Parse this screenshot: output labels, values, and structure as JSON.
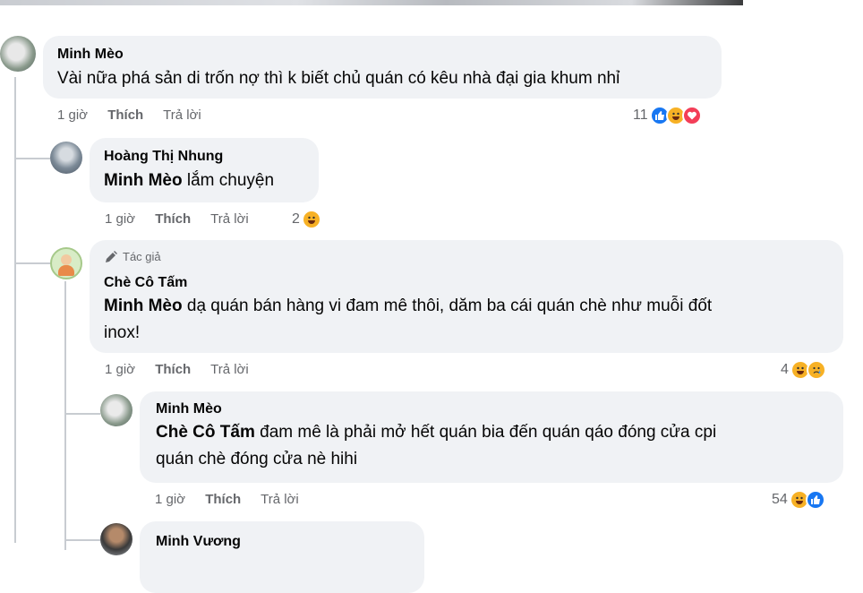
{
  "comments": [
    {
      "name": "Minh Mèo",
      "text": "Vài nữa phá sản di trốn nợ thì k biết chủ quán có kêu nhà đại gia khum nhỉ",
      "time": "1 giờ",
      "like": "Thích",
      "reply": "Trả lời",
      "count": "11",
      "reactions": [
        "like-icon",
        "haha-icon",
        "love-icon"
      ]
    },
    {
      "name": "Hoàng Thị Nhung",
      "mention": "Minh Mèo",
      "text": " lắm chuyện",
      "time": "1 giờ",
      "like": "Thích",
      "reply": "Trả lời",
      "count": "2",
      "reactions": [
        "haha-icon"
      ]
    },
    {
      "author_badge": "Tác giả",
      "name": "Chè Cô Tấm",
      "mention": "Minh Mèo",
      "text_line1": " dạ quán bán hàng vi đam mê thôi, dăm ba cái quán chè như muỗi đốt",
      "text_line2": "inox!",
      "time": "1 giờ",
      "like": "Thích",
      "reply": "Trả lời",
      "count": "4",
      "reactions": [
        "haha-icon",
        "sad-icon"
      ]
    },
    {
      "name": "Minh Mèo",
      "mention": "Chè Cô Tấm",
      "text_line1": " đam mê là phải mở hết quán bia đến quán qáo đóng cửa cpi",
      "text_line2": "quán chè đóng cửa nè hihi",
      "time": "1 giờ",
      "like": "Thích",
      "reply": "Trả lời",
      "count": "54",
      "reactions": [
        "haha-icon",
        "like-icon"
      ]
    },
    {
      "name": "Minh Vương"
    }
  ],
  "colors": {
    "bubble": "#f0f2f5",
    "meta": "#65676b",
    "like": "#1877f2",
    "love": "#f33e58",
    "haha": "#f7b125",
    "thread": "#c8ccd1"
  }
}
